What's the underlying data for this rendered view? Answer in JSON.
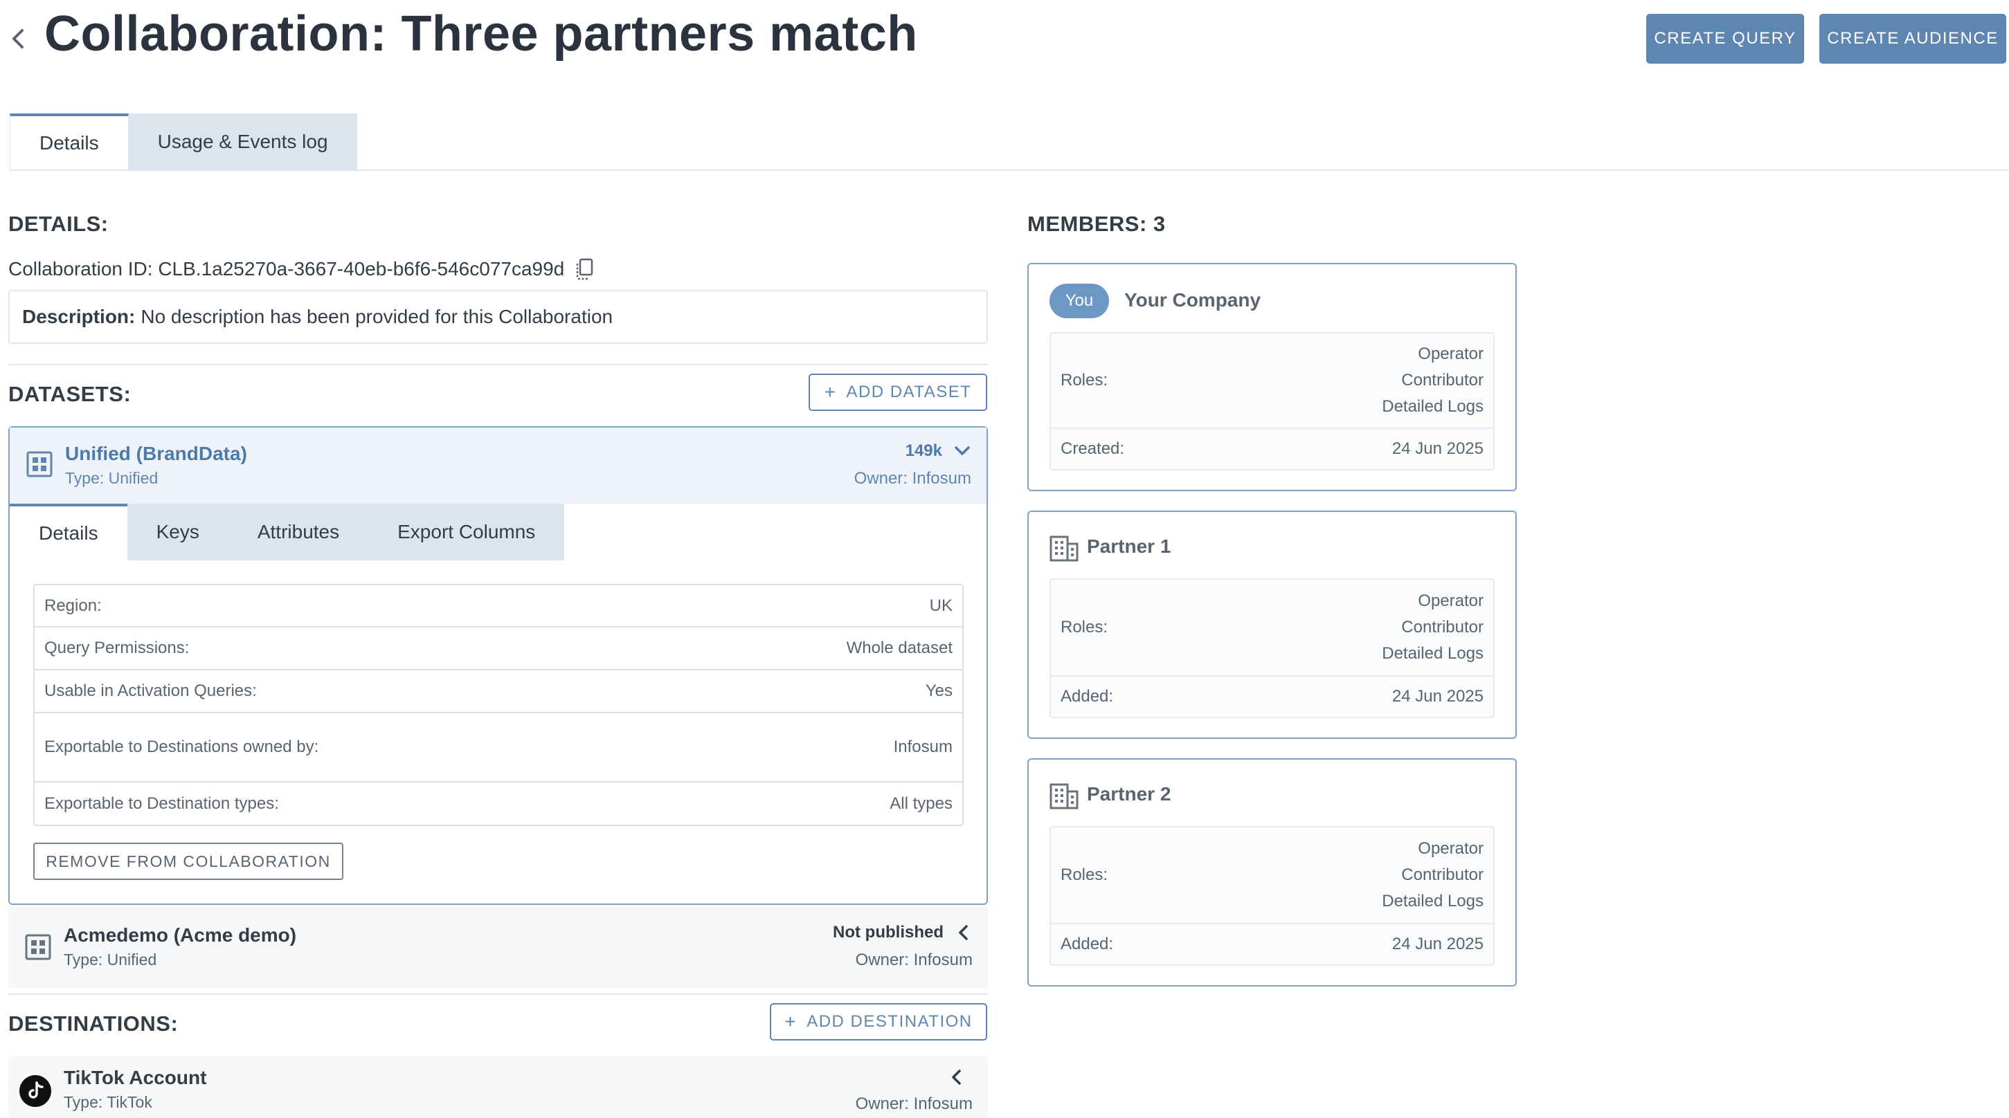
{
  "header": {
    "title": "Collaboration: Three partners match",
    "create_query": "CREATE QUERY",
    "create_audience": "CREATE AUDIENCE"
  },
  "tabs": [
    "Details",
    "Usage & Events log"
  ],
  "details": {
    "heading": "DETAILS:",
    "collab_id": "Collaboration ID: CLB.1a25270a-3667-40eb-b6f6-546c077ca99d",
    "desc_label": "Description:",
    "desc_text": "No description has been provided for this Collaboration"
  },
  "datasets": {
    "heading": "DATASETS:",
    "add_label": "ADD DATASET",
    "items": [
      {
        "name": "Unified (BrandData)",
        "type": "Type: Unified",
        "count": "149k",
        "owner": "Owner: Infosum",
        "tabs": [
          "Details",
          "Keys",
          "Attributes",
          "Export Columns"
        ],
        "props": [
          {
            "label": "Region:",
            "value": "UK"
          },
          {
            "label": "Query Permissions:",
            "value": "Whole dataset"
          },
          {
            "label": "Usable in Activation Queries:",
            "value": "Yes"
          },
          {
            "label": "Exportable to Destinations owned by:",
            "value": "Infosum"
          },
          {
            "label": "Exportable to Destination types:",
            "value": "All types"
          }
        ],
        "remove_label": "REMOVE FROM COLLABORATION"
      },
      {
        "name": "Acmedemo (Acme demo)",
        "type": "Type: Unified",
        "status": "Not published",
        "owner": "Owner: Infosum"
      }
    ]
  },
  "destinations": {
    "heading": "DESTINATIONS:",
    "add_label": "ADD DESTINATION",
    "items": [
      {
        "name": "TikTok Account",
        "type": "Type: TikTok",
        "owner": "Owner: Infosum"
      }
    ]
  },
  "members": {
    "heading": "MEMBERS: 3",
    "items": [
      {
        "badge": "You",
        "name": "Your Company",
        "roles_label": "Roles:",
        "roles": [
          "Operator",
          "Contributor",
          "Detailed Logs"
        ],
        "date_label": "Created:",
        "date": "24 Jun 2025"
      },
      {
        "name": "Partner 1",
        "roles_label": "Roles:",
        "roles": [
          "Operator",
          "Contributor",
          "Detailed Logs"
        ],
        "date_label": "Added:",
        "date": "24 Jun 2025"
      },
      {
        "name": "Partner 2",
        "roles_label": "Roles:",
        "roles": [
          "Operator",
          "Contributor",
          "Detailed Logs"
        ],
        "date_label": "Added:",
        "date": "24 Jun 2025"
      }
    ]
  },
  "colors": {
    "accent": "#5e86b0",
    "tab_bg": "#dce4ee",
    "card_border": "#7fa3c7",
    "text": "#333d47"
  },
  "icons": [
    "chevron-left-icon",
    "copy-icon",
    "plus-icon",
    "grid-icon",
    "chevron-down-icon",
    "building-icon",
    "tiktok-icon"
  ]
}
